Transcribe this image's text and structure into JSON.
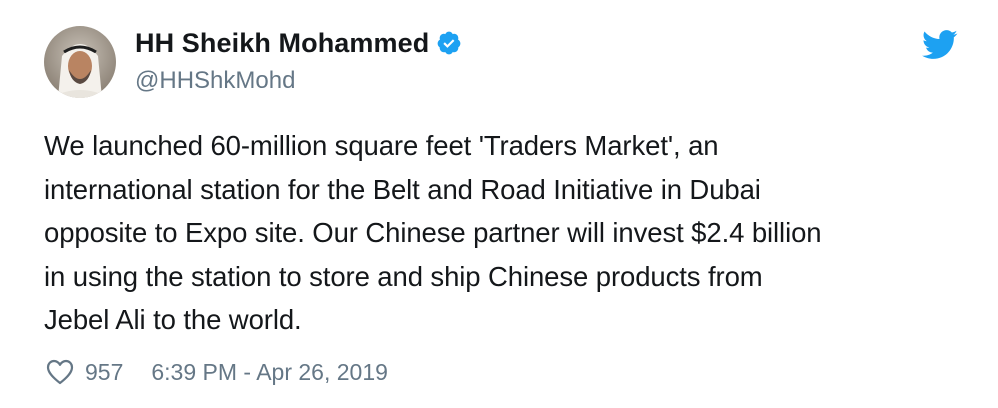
{
  "author": {
    "display_name": "HH Sheikh Mohammed",
    "handle": "@HHShkMohd",
    "verified": true,
    "avatar_icon": "avatar"
  },
  "icons": {
    "verified": "verified-badge-icon",
    "brand": "twitter-bird-icon",
    "like": "heart-icon"
  },
  "colors": {
    "twitter_blue": "#1da1f2",
    "text": "#14171a",
    "secondary_text": "#657786"
  },
  "tweet": {
    "lines": [
      "We launched 60-million square feet 'Traders Market', an",
      "international station for the Belt and Road Initiative in Dubai",
      "opposite to Expo site. Our Chinese partner will invest $2.4 billion",
      "in using the station to store and ship Chinese products from",
      "Jebel Ali to the world."
    ]
  },
  "footer": {
    "likes": "957",
    "timestamp": "6:39 PM - Apr 26, 2019"
  }
}
